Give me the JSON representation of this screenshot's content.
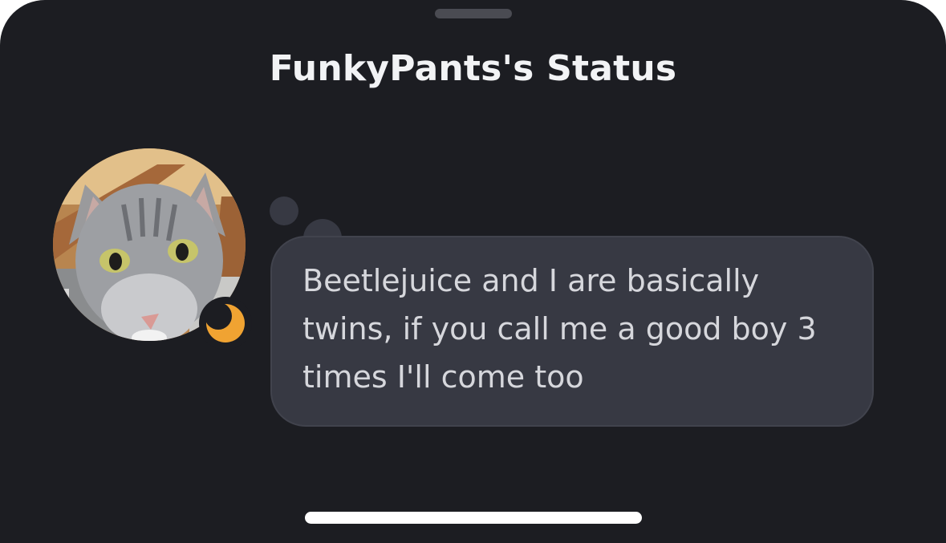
{
  "sheet": {
    "title": "FunkyPants's Status"
  },
  "profile": {
    "avatar": "cat-photo-avatar",
    "status_icon": "moon-icon",
    "status_color": "#f0a332"
  },
  "status_bubble": {
    "text": "Beetlejuice and I are basically twins, if you call me a good boy 3 times I'll come too"
  },
  "colors": {
    "background": "#1c1d22",
    "bubble": "#373943",
    "title_text": "#f2f3f5",
    "bubble_text": "#d6d7dc"
  }
}
